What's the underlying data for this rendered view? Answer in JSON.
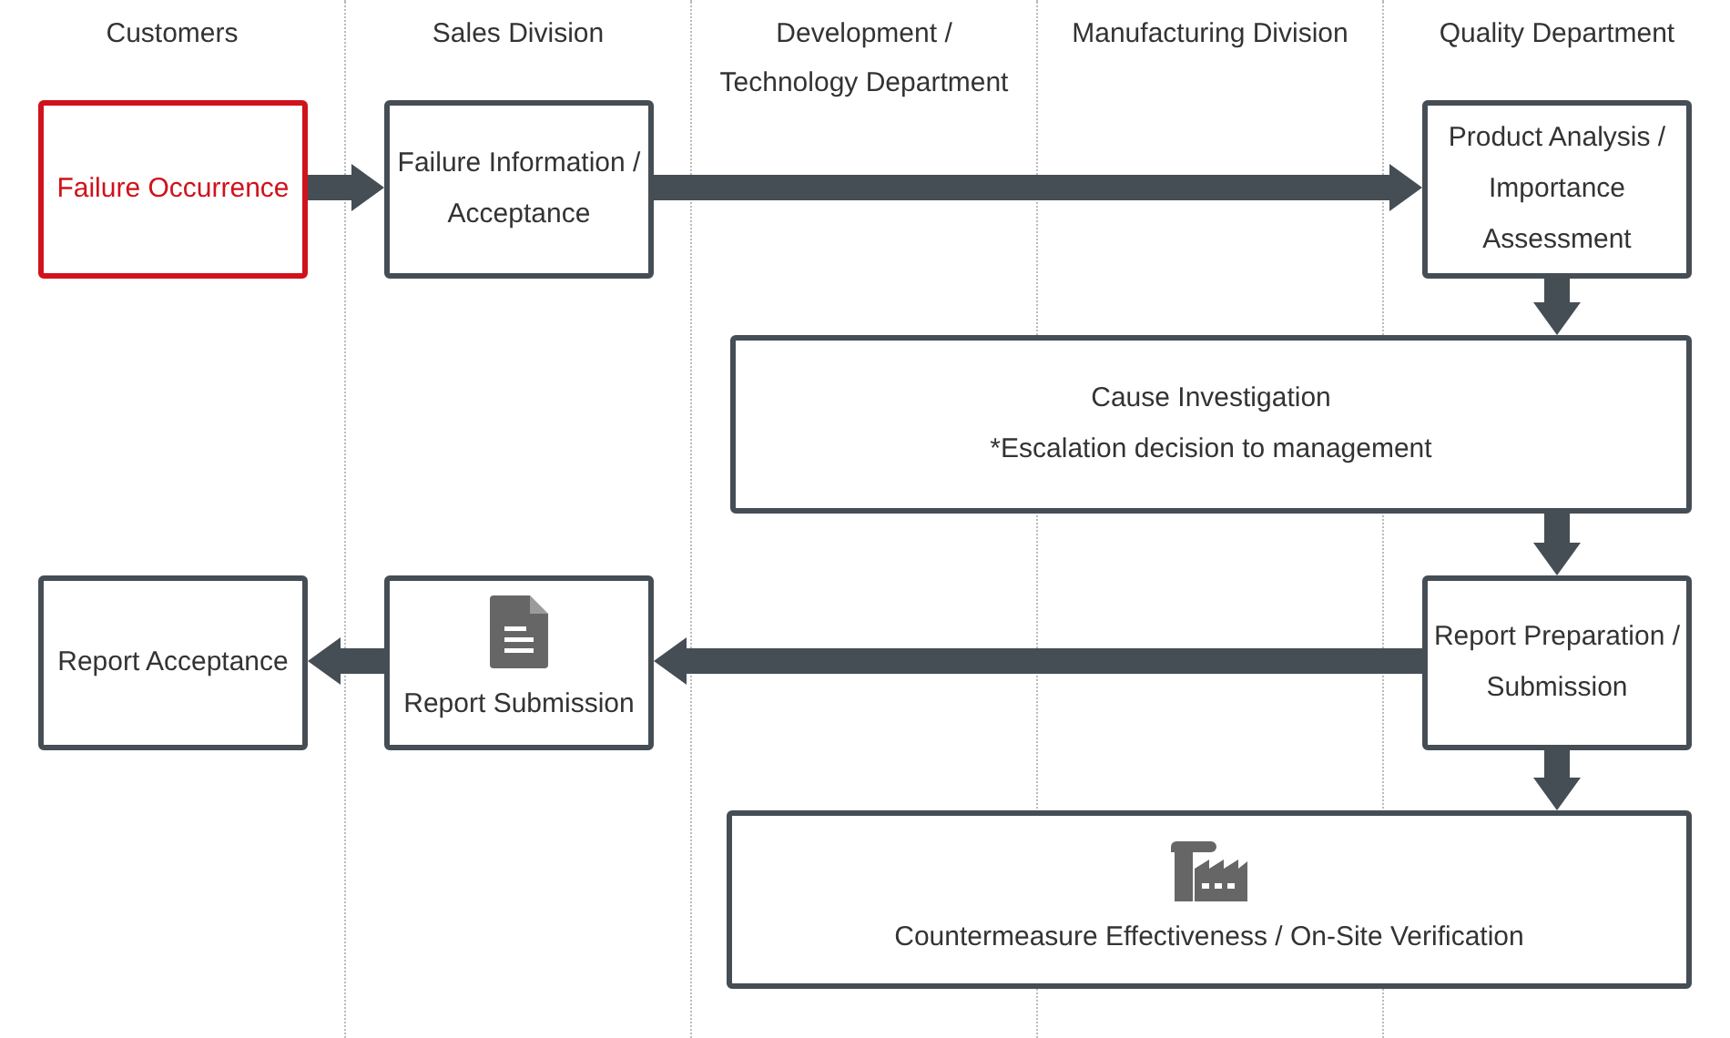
{
  "lanes": [
    {
      "title": "Customers"
    },
    {
      "title": "Sales Division"
    },
    {
      "title": "Development /\nTechnology Department"
    },
    {
      "title": "Manufacturing Division"
    },
    {
      "title": "Quality Department"
    }
  ],
  "nodes": [
    {
      "kind": "plain",
      "highlighted": true,
      "text": "Failure Occurrence"
    },
    {
      "kind": "plain",
      "highlighted": false,
      "text": "Failure Information /\nAcceptance"
    },
    {
      "kind": "plain",
      "highlighted": false,
      "text": "Product Analysis /\nImportance\nAssessment"
    },
    {
      "kind": "plain",
      "highlighted": false,
      "text": "Cause Investigation\n*Escalation decision to management"
    },
    {
      "kind": "plain",
      "highlighted": false,
      "text": "Report Acceptance"
    },
    {
      "kind": "document",
      "highlighted": false,
      "text": "Report Submission"
    },
    {
      "kind": "plain",
      "highlighted": false,
      "text": "Report Preparation /\nSubmission"
    },
    {
      "kind": "factory",
      "highlighted": false,
      "text": "Countermeasure Effectiveness / On-Site Verification"
    }
  ]
}
